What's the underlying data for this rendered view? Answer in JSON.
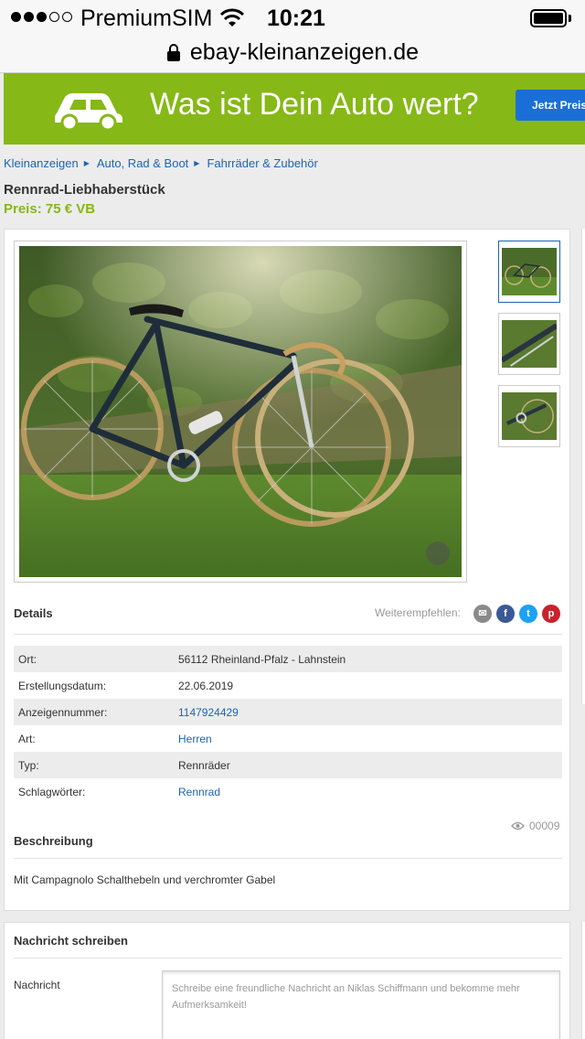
{
  "status_bar": {
    "carrier": "PremiumSIM",
    "time": "10:21",
    "url": "ebay-kleinanzeigen.de"
  },
  "banner": {
    "headline": "Was ist Dein Auto wert?",
    "button_label": "Jetzt Preis",
    "background_color": "#86b817",
    "icon": "car-icon"
  },
  "breadcrumb": [
    "Kleinanzeigen",
    "Auto, Rad & Boot",
    "Fahrräder & Zubehör"
  ],
  "listing": {
    "title": "Rennrad-Liebhaberstück",
    "price": "Preis: 75 € VB",
    "price_color": "#86b817"
  },
  "details": {
    "heading": "Details",
    "share_label": "Weiterempfehlen:",
    "share_icons": [
      "mail-icon",
      "facebook-icon",
      "twitter-icon",
      "pinterest-icon"
    ],
    "rows": [
      {
        "label": "Ort:",
        "value": "56112 Rheinland-Pfalz - Lahnstein"
      },
      {
        "label": "Erstellungsdatum:",
        "value": "22.06.2019"
      },
      {
        "label": "Anzeigennummer:",
        "value": "1147924429"
      },
      {
        "label": "Art:",
        "value": "Herren"
      },
      {
        "label": "Typ:",
        "value": "Rennräder"
      },
      {
        "label": "Schlagwörter:",
        "value": "Rennrad"
      }
    ],
    "views": "00009"
  },
  "description": {
    "heading": "Beschreibung",
    "text": "Mit Campagnolo Schalthebeln und verchromter Gabel"
  },
  "message": {
    "heading": "Nachricht schreiben",
    "label": "Nachricht",
    "placeholder": "Schreibe eine freundliche Nachricht an Niklas Schiffmann und bekomme mehr Aufmerksamkeit!"
  }
}
